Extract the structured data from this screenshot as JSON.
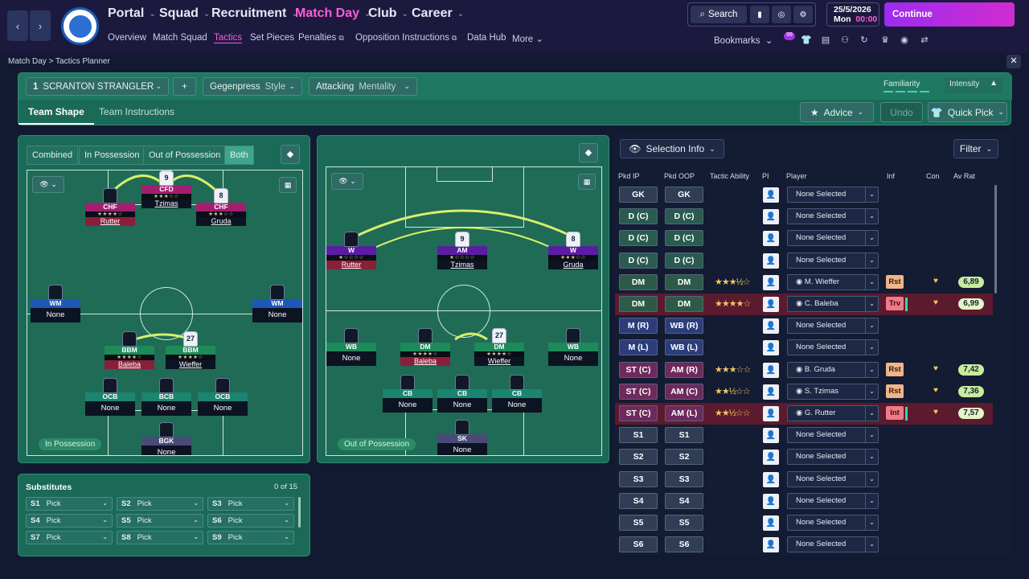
{
  "nav": {
    "menus": [
      "Portal",
      "Squad",
      "Recruitment",
      "Match Day",
      "Club",
      "Career"
    ],
    "active_menu": "Match Day",
    "sub": [
      "Overview",
      "Match Squad",
      "Tactics",
      "Set Pieces",
      "Penalties",
      "Opposition Instructions",
      "Data Hub",
      "More"
    ],
    "active_sub": "Tactics",
    "search_label": "Search",
    "date": "25/5/2026",
    "day": "Mon",
    "time": "00:00",
    "continue_label": "Continue",
    "bookmarks_label": "Bookmarks",
    "badge": "99"
  },
  "breadcrumb": {
    "parent": "Match Day",
    "current": "Tactics Planner"
  },
  "tactic": {
    "number": "1",
    "name": "SCRANTON STRANGLER",
    "style_value": "Gegenpress",
    "style_label": "Style",
    "mentality_value": "Attacking",
    "mentality_label": "Mentality",
    "familiarity_label": "Familiarity",
    "intensity_label": "Intensity",
    "tabs": [
      "Team Shape",
      "Team Instructions"
    ],
    "advice_label": "Advice",
    "undo_label": "Undo",
    "quickpick_label": "Quick Pick"
  },
  "inpos": {
    "modes": [
      "Combined",
      "In Possession",
      "Out of Possession",
      "Both"
    ],
    "active_mode": "Both",
    "badge": "In Possession",
    "players": [
      {
        "role": "CFD",
        "stars": "★★★☆☆",
        "name": "Tzimas",
        "shirt": "9",
        "color": "r-attack",
        "white": true,
        "red": false
      },
      {
        "role": "CHF",
        "stars": "★★★★☆",
        "name": "Rutter",
        "shirt": "",
        "color": "r-attack",
        "white": false,
        "red": true
      },
      {
        "role": "CHF",
        "stars": "★★★☆☆",
        "name": "Gruda",
        "shirt": "8",
        "color": "r-attack",
        "white": true,
        "red": false
      },
      {
        "role": "WM",
        "stars": "",
        "name": "None",
        "shirt": "",
        "color": "r-blue",
        "white": false,
        "red": false
      },
      {
        "role": "WM",
        "stars": "",
        "name": "None",
        "shirt": "",
        "color": "r-blue",
        "white": false,
        "red": false
      },
      {
        "role": "BBM",
        "stars": "★★★★☆",
        "name": "Baleba",
        "shirt": "",
        "color": "r-green",
        "white": false,
        "red": true
      },
      {
        "role": "BBM",
        "stars": "★★★★☆",
        "name": "Wieffer",
        "shirt": "27",
        "color": "r-green",
        "white": true,
        "red": false
      },
      {
        "role": "OCB",
        "stars": "",
        "name": "None",
        "shirt": "",
        "color": "r-teal",
        "white": false,
        "red": false
      },
      {
        "role": "BCB",
        "stars": "",
        "name": "None",
        "shirt": "",
        "color": "r-teal",
        "white": false,
        "red": false
      },
      {
        "role": "OCB",
        "stars": "",
        "name": "None",
        "shirt": "",
        "color": "r-teal",
        "white": false,
        "red": false
      },
      {
        "role": "BGK",
        "stars": "",
        "name": "None",
        "shirt": "",
        "color": "r-gk",
        "white": false,
        "red": false
      }
    ]
  },
  "outpos": {
    "badge": "Out of Possession",
    "players": [
      {
        "role": "W",
        "stars": "★☆☆☆☆",
        "name": "Rutter",
        "shirt": "",
        "color": "r-mid",
        "white": false,
        "red": true
      },
      {
        "role": "AM",
        "stars": "★☆☆☆☆",
        "name": "Tzimas",
        "shirt": "9",
        "color": "r-mid",
        "white": true,
        "red": false
      },
      {
        "role": "W",
        "stars": "★★★☆☆",
        "name": "Gruda",
        "shirt": "8",
        "color": "r-mid",
        "white": true,
        "red": false
      },
      {
        "role": "WB",
        "stars": "",
        "name": "None",
        "shirt": "",
        "color": "r-green",
        "white": false,
        "red": false
      },
      {
        "role": "DM",
        "stars": "★★★★☆",
        "name": "Baleba",
        "shirt": "",
        "color": "r-green",
        "white": false,
        "red": true
      },
      {
        "role": "DM",
        "stars": "★★★★☆",
        "name": "Wieffer",
        "shirt": "27",
        "color": "r-green",
        "white": true,
        "red": false
      },
      {
        "role": "WB",
        "stars": "",
        "name": "None",
        "shirt": "",
        "color": "r-green",
        "white": false,
        "red": false
      },
      {
        "role": "CB",
        "stars": "",
        "name": "None",
        "shirt": "",
        "color": "r-teal",
        "white": false,
        "red": false
      },
      {
        "role": "CB",
        "stars": "",
        "name": "None",
        "shirt": "",
        "color": "r-teal",
        "white": false,
        "red": false
      },
      {
        "role": "CB",
        "stars": "",
        "name": "None",
        "shirt": "",
        "color": "r-teal",
        "white": false,
        "red": false
      },
      {
        "role": "SK",
        "stars": "",
        "name": "None",
        "shirt": "",
        "color": "r-gk",
        "white": false,
        "red": false
      }
    ]
  },
  "subs": {
    "title": "Substitutes",
    "count": "0 of 15",
    "slots": [
      {
        "id": "S1",
        "val": "Pick"
      },
      {
        "id": "S2",
        "val": "Pick"
      },
      {
        "id": "S3",
        "val": "Pick"
      },
      {
        "id": "S4",
        "val": "Pick"
      },
      {
        "id": "S5",
        "val": "Pick"
      },
      {
        "id": "S6",
        "val": "Pick"
      },
      {
        "id": "S7",
        "val": "Pick"
      },
      {
        "id": "S8",
        "val": "Pick"
      },
      {
        "id": "S9",
        "val": "Pick"
      }
    ]
  },
  "selection": {
    "title": "Selection Info",
    "filter": "Filter",
    "headers": [
      "Pkd IP",
      "Pkd OOP",
      "Tactic Ability",
      "PI",
      "Player",
      "Inf",
      "Con",
      "Av Rat"
    ],
    "rows": [
      {
        "ip": "GK",
        "oop": "GK",
        "stars": "",
        "player": "None Selected",
        "inf": "",
        "rat": "",
        "tone": "",
        "hl": false
      },
      {
        "ip": "D (C)",
        "oop": "D (C)",
        "stars": "",
        "player": "None Selected",
        "inf": "",
        "rat": "",
        "tone": "greenb",
        "hl": false
      },
      {
        "ip": "D (C)",
        "oop": "D (C)",
        "stars": "",
        "player": "None Selected",
        "inf": "",
        "rat": "",
        "tone": "greenb",
        "hl": false
      },
      {
        "ip": "D (C)",
        "oop": "D (C)",
        "stars": "",
        "player": "None Selected",
        "inf": "",
        "rat": "",
        "tone": "greenb",
        "hl": false
      },
      {
        "ip": "DM",
        "oop": "DM",
        "stars": "★★★½☆",
        "player": "M. Wieffer",
        "inf": "Rst",
        "rat": "6,89",
        "tone": "dmb",
        "hl": false
      },
      {
        "ip": "DM",
        "oop": "DM",
        "stars": "★★★★☆",
        "player": "C. Baleba",
        "inf": "Trv",
        "rat": "6,99",
        "tone": "dmb",
        "hl": true
      },
      {
        "ip": "M (R)",
        "oop": "WB (R)",
        "stars": "",
        "player": "None Selected",
        "inf": "",
        "rat": "",
        "tone": "blueb",
        "hl": false
      },
      {
        "ip": "M (L)",
        "oop": "WB (L)",
        "stars": "",
        "player": "None Selected",
        "inf": "",
        "rat": "",
        "tone": "blueb",
        "hl": false
      },
      {
        "ip": "ST (C)",
        "oop": "AM (R)",
        "stars": "★★★☆☆",
        "player": "B. Gruda",
        "inf": "Rst",
        "rat": "7,42",
        "tone": "pinkb",
        "hl": false
      },
      {
        "ip": "ST (C)",
        "oop": "AM (C)",
        "stars": "★★½☆☆",
        "player": "S. Tzimas",
        "inf": "Rst",
        "rat": "7,36",
        "tone": "pinkb",
        "hl": false
      },
      {
        "ip": "ST (C)",
        "oop": "AM (L)",
        "stars": "★★½☆☆",
        "player": "G. Rutter",
        "inf": "Int",
        "rat": "7,57",
        "tone": "pinkb",
        "hl": true
      },
      {
        "ip": "S1",
        "oop": "S1",
        "stars": "",
        "player": "None Selected",
        "inf": "",
        "rat": "",
        "tone": "",
        "hl": false
      },
      {
        "ip": "S2",
        "oop": "S2",
        "stars": "",
        "player": "None Selected",
        "inf": "",
        "rat": "",
        "tone": "",
        "hl": false
      },
      {
        "ip": "S3",
        "oop": "S3",
        "stars": "",
        "player": "None Selected",
        "inf": "",
        "rat": "",
        "tone": "",
        "hl": false
      },
      {
        "ip": "S4",
        "oop": "S4",
        "stars": "",
        "player": "None Selected",
        "inf": "",
        "rat": "",
        "tone": "",
        "hl": false
      },
      {
        "ip": "S5",
        "oop": "S5",
        "stars": "",
        "player": "None Selected",
        "inf": "",
        "rat": "",
        "tone": "",
        "hl": false
      },
      {
        "ip": "S6",
        "oop": "S6",
        "stars": "",
        "player": "None Selected",
        "inf": "",
        "rat": "",
        "tone": "",
        "hl": false
      }
    ]
  }
}
